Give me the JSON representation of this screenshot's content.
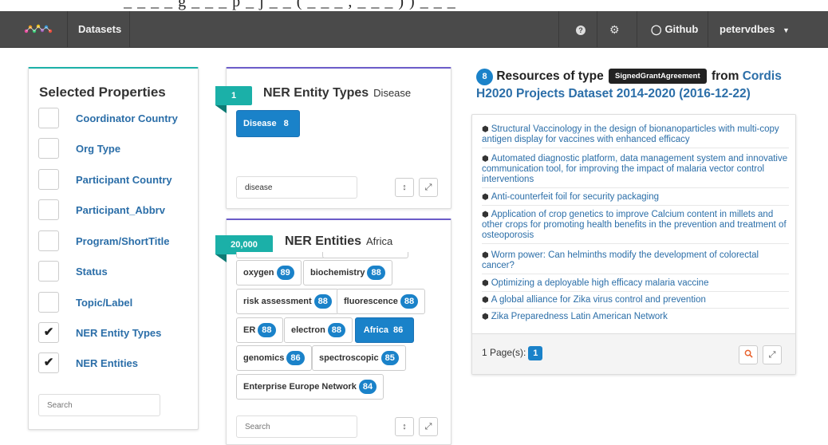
{
  "top_fragment": "\" _ _ _ _ g _ _ _ p _ j _ _ ( _ _ _ , _ _ _ ) ) _ _ _",
  "navbar": {
    "datasets_label": "Datasets",
    "help_icon": "question-circle-icon",
    "settings_icon": "gears-icon",
    "github_label": "Github",
    "user_label": "petervdbes"
  },
  "selected_properties": {
    "title": "Selected Properties",
    "items": [
      {
        "label": "Coordinator Country",
        "checked": false
      },
      {
        "label": "Org Type",
        "checked": false
      },
      {
        "label": "Participant Country",
        "checked": false
      },
      {
        "label": "Participant_Abbrv",
        "checked": false
      },
      {
        "label": "Program/ShortTitle",
        "checked": false
      },
      {
        "label": "Status",
        "checked": false
      },
      {
        "label": "Topic/Label",
        "checked": false
      },
      {
        "label": "NER Entity Types",
        "checked": true
      },
      {
        "label": "NER Entities",
        "checked": true
      }
    ],
    "search_placeholder": "Search"
  },
  "facet_entity_types": {
    "count": "1",
    "title": "NER Entity Types",
    "selected": "Disease",
    "tags": [
      {
        "label": "Disease",
        "count": "8",
        "active": true
      }
    ],
    "search_value": "disease"
  },
  "facet_entities": {
    "count": "20,000",
    "title": "NER Entities",
    "selected": "Africa",
    "tags": [
      {
        "label": "oxygen",
        "count": "89",
        "active": false
      },
      {
        "label": "biochemistry",
        "count": "88",
        "active": false
      },
      {
        "label": "risk assessment",
        "count": "88",
        "active": false
      },
      {
        "label": "fluorescence",
        "count": "88",
        "active": false
      },
      {
        "label": "ER",
        "count": "88",
        "active": false
      },
      {
        "label": "electron",
        "count": "88",
        "active": false
      },
      {
        "label": "Africa",
        "count": "86",
        "active": true
      },
      {
        "label": "genomics",
        "count": "86",
        "active": false
      },
      {
        "label": "spectroscopic",
        "count": "85",
        "active": false
      },
      {
        "label": "Enterprise Europe Network",
        "count": "84",
        "active": false
      }
    ],
    "search_placeholder": "Search"
  },
  "resources": {
    "count": "8",
    "prefix": "Resources of type",
    "type": "SignedGrantAgreement",
    "from": "from",
    "dataset": "Cordis H2020 Projects Dataset 2014-2020 (2016-12-22)",
    "items": [
      "Structural Vaccinology in the design of bionanoparticles with multi-copy antigen display for vaccines with enhanced efficacy",
      "Automated diagnostic platform, data management system and innovative communication tool, for improving the impact of malaria vector control interventions",
      "Anti-counterfeit foil for security packaging",
      "Application of crop genetics to improve Calcium content in millets and other crops for promoting health benefits in the prevention and treatment of osteoporosis",
      "Worm power: Can helminths modify the development of colorectal cancer?",
      "Optimizing a deployable high efficacy malaria vaccine",
      "A global alliance for Zika virus control and prevention",
      "Zika Preparedness Latin American Network"
    ],
    "pages_label": "1 Page(s):",
    "current_page": "1"
  },
  "colors": {
    "navbar": "#4a4a4a",
    "teal": "#1bb0a8",
    "purple": "#6b5cc9",
    "blue": "#1a82c9",
    "link": "#2b6ea8",
    "search_button": "#e8612c"
  }
}
